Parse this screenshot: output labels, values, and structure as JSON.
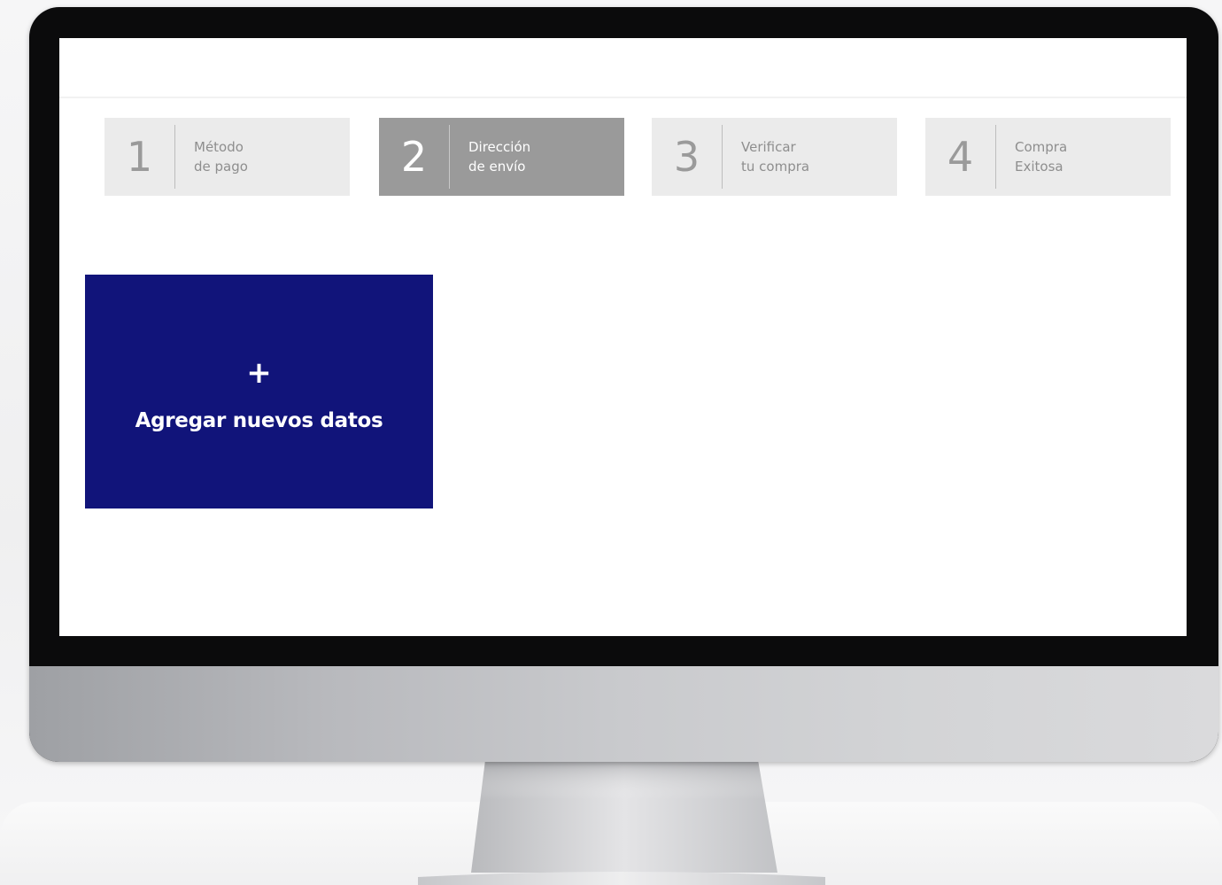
{
  "steps": [
    {
      "number": "1",
      "line1": "Método",
      "line2": "de pago",
      "active": false
    },
    {
      "number": "2",
      "line1": "Dirección",
      "line2": "de envío",
      "active": true
    },
    {
      "number": "3",
      "line1": "Verificar",
      "line2": "tu compra",
      "active": false
    },
    {
      "number": "4",
      "line1": "Compra",
      "line2": "Exitosa",
      "active": false
    }
  ],
  "add_card": {
    "plus": "+",
    "label": "Agregar nuevos datos"
  },
  "colors": {
    "add_card_bg": "#11147a",
    "step_active_bg": "#9a9a9a",
    "step_inactive_bg": "#ebebeb"
  }
}
